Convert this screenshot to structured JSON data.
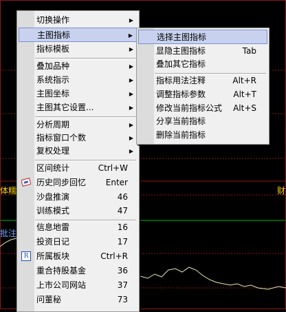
{
  "chart": {
    "left_label": "体糯",
    "right_label": "财",
    "lower_label": "批注",
    "colors": {
      "grid": "#8b1a1a",
      "bright_line": "#00c000",
      "curve": "#e8e8b0",
      "label": "#ffd200"
    }
  },
  "main_menu": {
    "items": [
      {
        "label": "切换操作",
        "arrow": "▶"
      },
      {
        "label": "主图指标",
        "arrow": "▶"
      },
      {
        "label": "指标模板",
        "arrow": "▶"
      },
      {
        "label": "叠加品种",
        "arrow": "▶"
      },
      {
        "label": "系统指示",
        "arrow": "▶"
      },
      {
        "label": "主图坐标",
        "arrow": "▶"
      },
      {
        "label": "主图其它设置...",
        "arrow": "▶"
      },
      {
        "label": "分析周期",
        "arrow": "▶"
      },
      {
        "label": "指标窗口个数",
        "arrow": "▶"
      },
      {
        "label": "复权处理",
        "arrow": "▶"
      },
      {
        "label": "区间统计",
        "shortcut": "Ctrl+W"
      },
      {
        "label": "历史同步回忆",
        "shortcut": "Enter",
        "icon": "memory-icon"
      },
      {
        "label": "沙盘推演",
        "shortcut": "46"
      },
      {
        "label": "训练模式",
        "shortcut": "47"
      },
      {
        "label": "信息地雷",
        "shortcut": "16"
      },
      {
        "label": "投资日记",
        "shortcut": "17"
      },
      {
        "label": "所属板块",
        "shortcut": "Ctrl+R",
        "icon": "sector-r-icon",
        "icon_text": "R"
      },
      {
        "label": "重合持股基金",
        "shortcut": "36"
      },
      {
        "label": "上市公司网站",
        "shortcut": "37"
      },
      {
        "label": "问董秘",
        "shortcut": "73"
      }
    ]
  },
  "sub_menu": {
    "items": [
      {
        "label": "选择主图指标"
      },
      {
        "label": "显隐主图指标",
        "shortcut": "Tab"
      },
      {
        "label": "叠加其它指标"
      },
      {
        "label": "指标用法注释",
        "shortcut": "Alt+R"
      },
      {
        "label": "调整指标参数",
        "shortcut": "Alt+T"
      },
      {
        "label": "修改当前指标公式",
        "shortcut": "Alt+S"
      },
      {
        "label": "分享当前指标"
      },
      {
        "label": "删除当前指标"
      }
    ]
  }
}
